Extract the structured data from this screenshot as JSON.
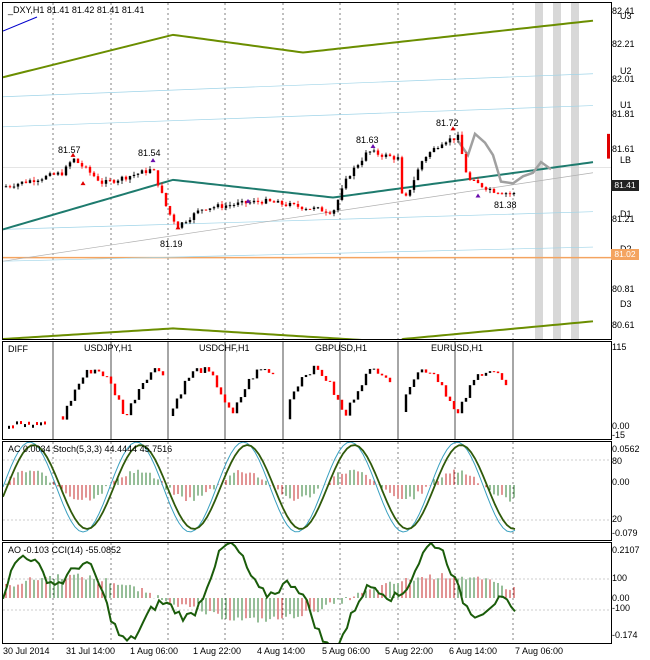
{
  "main_header": "_DXY,H1  81.41 81.42 81.41 81.41",
  "levels": [
    "U3",
    "U2",
    "U1",
    "LB",
    "D1",
    "D2",
    "D3"
  ],
  "price_ticks": [
    "82.41",
    "82.21",
    "82.01",
    "81.81",
    "81.61",
    "81.41",
    "81.21",
    "81.02",
    "80.81",
    "80.61"
  ],
  "current_price": "81.41",
  "level_price": "81.02",
  "annotations": [
    "81.57",
    "81.54",
    "81.19",
    "81.63",
    "81.72",
    "81.38"
  ],
  "sub1": {
    "header": "DIFF",
    "pairs": [
      "USDJPY,H1",
      "USDCHF,H1",
      "GBPUSD,H1",
      "EURUSD,H1"
    ],
    "ticks": [
      "115",
      "0.00",
      "-15"
    ]
  },
  "sub2": {
    "header": "AC 0.0034  Stoch(5,3,3) 44.4444 45.7516",
    "ticks": [
      "0.0562",
      "80",
      "0.00",
      "20",
      "-0.079"
    ]
  },
  "sub3": {
    "header": "AO -0.103  CCI(14) -55.0852",
    "ticks": [
      "0.2107",
      "100",
      "0.00",
      "-100",
      "-0.174"
    ]
  },
  "dates": [
    "30 Jul 2014",
    "31 Jul 14:00",
    "1 Aug 06:00",
    "1 Aug 22:00",
    "4 Aug 14:00",
    "5 Aug 06:00",
    "5 Aug 22:00",
    "6 Aug 14:00",
    "7 Aug 06:00"
  ],
  "colors": {
    "up": "#000000",
    "down": "#ff0000",
    "band": "#6b8e00",
    "midline": "#1e7b6e",
    "level_line": "#f4a460",
    "ghost": "#a0a0a0",
    "shade": "#d8d8d8"
  }
}
